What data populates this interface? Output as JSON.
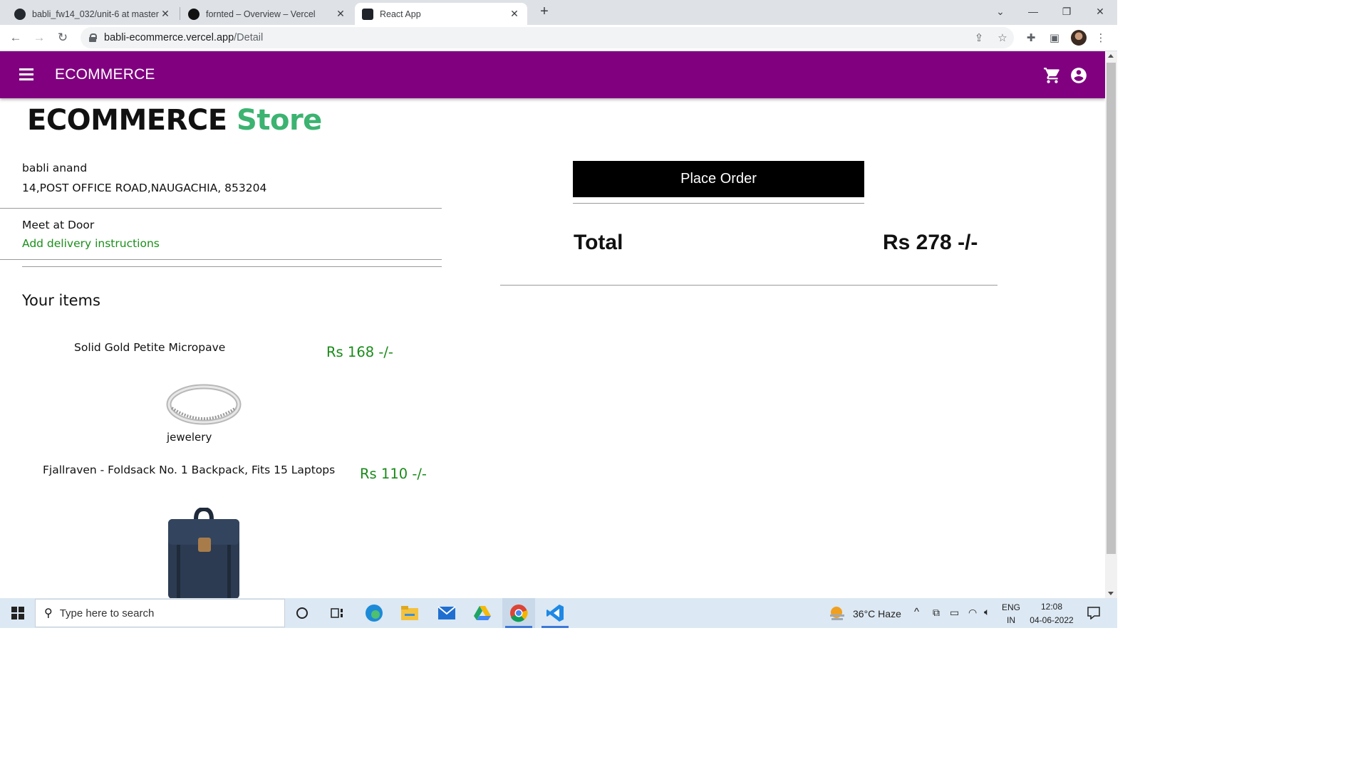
{
  "browser": {
    "tabs": [
      {
        "title": "babli_fw14_032/unit-6 at master",
        "active": false
      },
      {
        "title": "fornted – Overview – Vercel",
        "active": false
      },
      {
        "title": "React App",
        "active": true
      }
    ],
    "url_host": "babli-ecommerce.vercel.app",
    "url_path": "/Detail"
  },
  "appbar": {
    "brand": "ECOMMERCE"
  },
  "page": {
    "heading_main": "ECOMMERCE",
    "heading_accent": "Store",
    "customer_name": "babli anand",
    "customer_address": "14,POST OFFICE ROAD,NAUGACHIA, 853204",
    "delivery_option": "Meet at Door",
    "add_instructions": "Add delivery instructions",
    "your_items_title": "Your items",
    "items": [
      {
        "title": "Solid Gold Petite Micropave",
        "price": "Rs 168 -/-",
        "category": "jewelery"
      },
      {
        "title": "Fjallraven - Foldsack No. 1 Backpack, Fits 15 Laptops",
        "price": "Rs 110 -/-"
      }
    ],
    "place_order_label": "Place Order",
    "total_label": "Total",
    "total_value": "Rs 278 -/-"
  },
  "taskbar": {
    "search_placeholder": "Type here to search",
    "weather": "36°C  Haze",
    "lang_top": "ENG",
    "lang_bottom": "IN",
    "time": "12:08",
    "date": "04-06-2022"
  },
  "colors": {
    "appbar": "#800080",
    "accent_green": "#3cb371",
    "price_green": "#1a8a1a"
  }
}
